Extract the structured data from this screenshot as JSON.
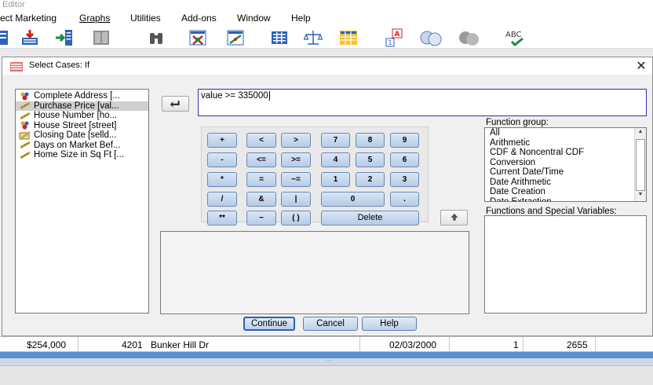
{
  "app": {
    "title": "Editor"
  },
  "menu": [
    "ect Marketing",
    "Graphs",
    "Utilities",
    "Add-ons",
    "Window",
    "Help"
  ],
  "toolbar": {
    "icons": [
      "select-cases-icon",
      "insert-cases-icon",
      "insert-variable-icon",
      "split-file-icon",
      "binoculars-icon",
      "value-labels-icon",
      "weight-cases-icon",
      "data-view-icon",
      "scale-icon",
      "grid-icon",
      "value-labels-ab-icon",
      "use-sets-icon",
      "show-all-icon",
      "spell-check-icon"
    ],
    "spellcheck_text": "ABC"
  },
  "dialog": {
    "title": "Select Cases: If",
    "close_label": "✕",
    "variables": [
      {
        "label": "Complete Address [...",
        "icon": "nominal-icon"
      },
      {
        "label": "Purchase Price [val...",
        "icon": "scale-var-icon"
      },
      {
        "label": "House Number [ho...",
        "icon": "scale-var-icon"
      },
      {
        "label": "House Street [street]",
        "icon": "nominal-icon"
      },
      {
        "label": "Closing Date [selld...",
        "icon": "date-var-icon"
      },
      {
        "label": "Days on Market Bef...",
        "icon": "scale-var-icon"
      },
      {
        "label": "Home Size in Sq Ft [...",
        "icon": "scale-var-icon"
      }
    ],
    "selected_variable_index": 1,
    "expression": "value >= 335000",
    "keypad": {
      "ops_col1": [
        "+",
        "-",
        "*",
        "/",
        "**"
      ],
      "ops_col2": [
        "<",
        "<=",
        "=",
        "&",
        "~"
      ],
      "ops_col3": [
        ">",
        ">=",
        "~=",
        "|",
        "( )"
      ],
      "digits_row1": [
        "7",
        "8",
        "9"
      ],
      "digits_row2": [
        "4",
        "5",
        "6"
      ],
      "digits_row3": [
        "1",
        "2",
        "3"
      ],
      "zero": "0",
      "dot": ".",
      "delete": "Delete"
    },
    "function_group_label": "Function group:",
    "function_groups": [
      "All",
      "Arithmetic",
      "CDF & Noncentral CDF",
      "Conversion",
      "Current Date/Time",
      "Date Arithmetic",
      "Date Creation",
      "Date Extraction"
    ],
    "functions_label": "Functions and Special Variables:",
    "buttons": {
      "continue": "Continue",
      "cancel": "Cancel",
      "help": "Help"
    }
  },
  "data_row": {
    "price": "$254,000",
    "house_number": "4201",
    "street": "Bunker Hill Dr",
    "closing_date": "02/03/2000",
    "days": "1",
    "size": "2655"
  },
  "scroll_grip": "···"
}
